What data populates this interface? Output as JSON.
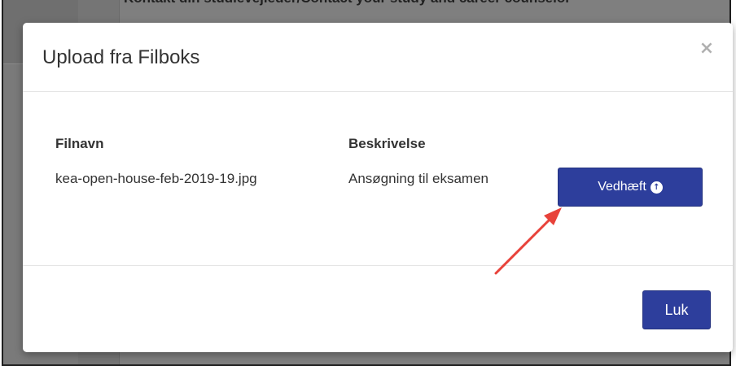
{
  "background": {
    "heading": "Kontakt din studievejleder/Contact your study and career counselor"
  },
  "modal": {
    "title": "Upload fra Filboks",
    "close_icon": "×",
    "table": {
      "headers": [
        "Filnavn",
        "Beskrivelse"
      ],
      "rows": [
        {
          "filename": "kea-open-house-feb-2019-19.jpg",
          "description": "Ansøgning til eksamen",
          "attach_label": "Vedhæft",
          "attach_icon": "upload-circle-icon"
        }
      ]
    },
    "footer": {
      "close_label": "Luk"
    }
  },
  "colors": {
    "primary_button": "#2d3e9c",
    "annotation_arrow": "#e8423a",
    "backdrop": "#7f7f7f"
  }
}
